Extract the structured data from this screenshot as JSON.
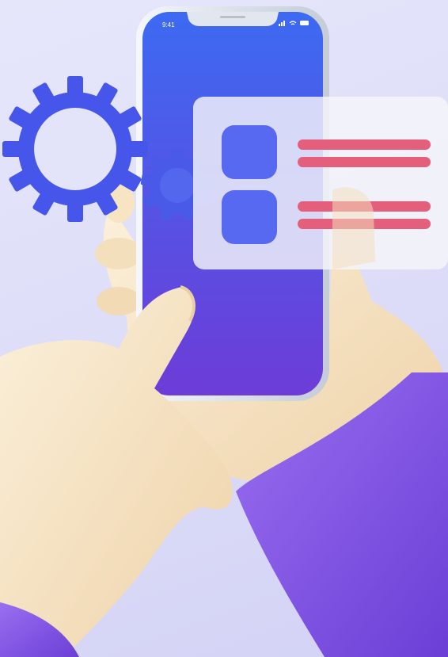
{
  "phone": {
    "status_time": "9:41",
    "screen_gradient": [
      "#3f66f1",
      "#6a3fd8"
    ],
    "frame_color": "#d9e0ea"
  },
  "card": {
    "tiles_color": "#5668f2",
    "bars_color": "#e35c78",
    "background": "#f3f3f8"
  },
  "decor": {
    "gear_color": "#4353ea",
    "sleeve_color": "#8156e6",
    "hand_color": "#f4e1bf",
    "icons": [
      "large-gear-icon",
      "small-gear-icon",
      "signal-icon",
      "wifi-icon",
      "battery-icon"
    ]
  }
}
